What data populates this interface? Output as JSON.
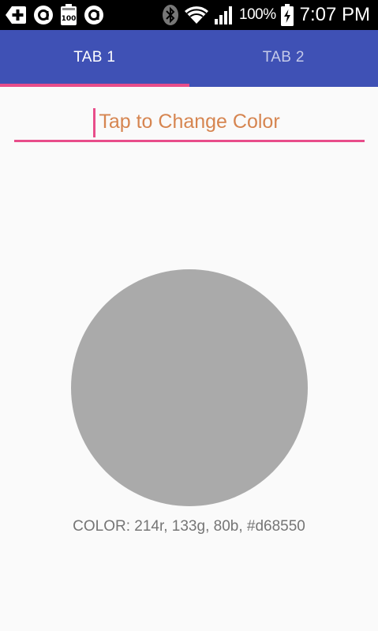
{
  "status_bar": {
    "icons_left": [
      "add-box-icon",
      "app-a-icon",
      "battery-100-notification-icon",
      "app-a-icon"
    ],
    "icons_right": [
      "bluetooth-icon",
      "wifi-icon",
      "signal-icon",
      "battery-charging-icon"
    ],
    "battery_percent": "100%",
    "time": "7:07 PM"
  },
  "tabs": [
    {
      "label": "TAB 1",
      "active": true
    },
    {
      "label": "TAB 2",
      "active": false
    }
  ],
  "color_input": {
    "placeholder": "Tap to Change Color",
    "value": "",
    "text_color": "#d68550"
  },
  "color_display": {
    "circle_color": "#aaaaaa",
    "readout": "COLOR: 214r, 133g, 80b, #d68550"
  },
  "colors": {
    "primary": "#3f51b5",
    "accent": "#e84d8a",
    "selected_color": "#d68550",
    "background": "#fafafa"
  }
}
